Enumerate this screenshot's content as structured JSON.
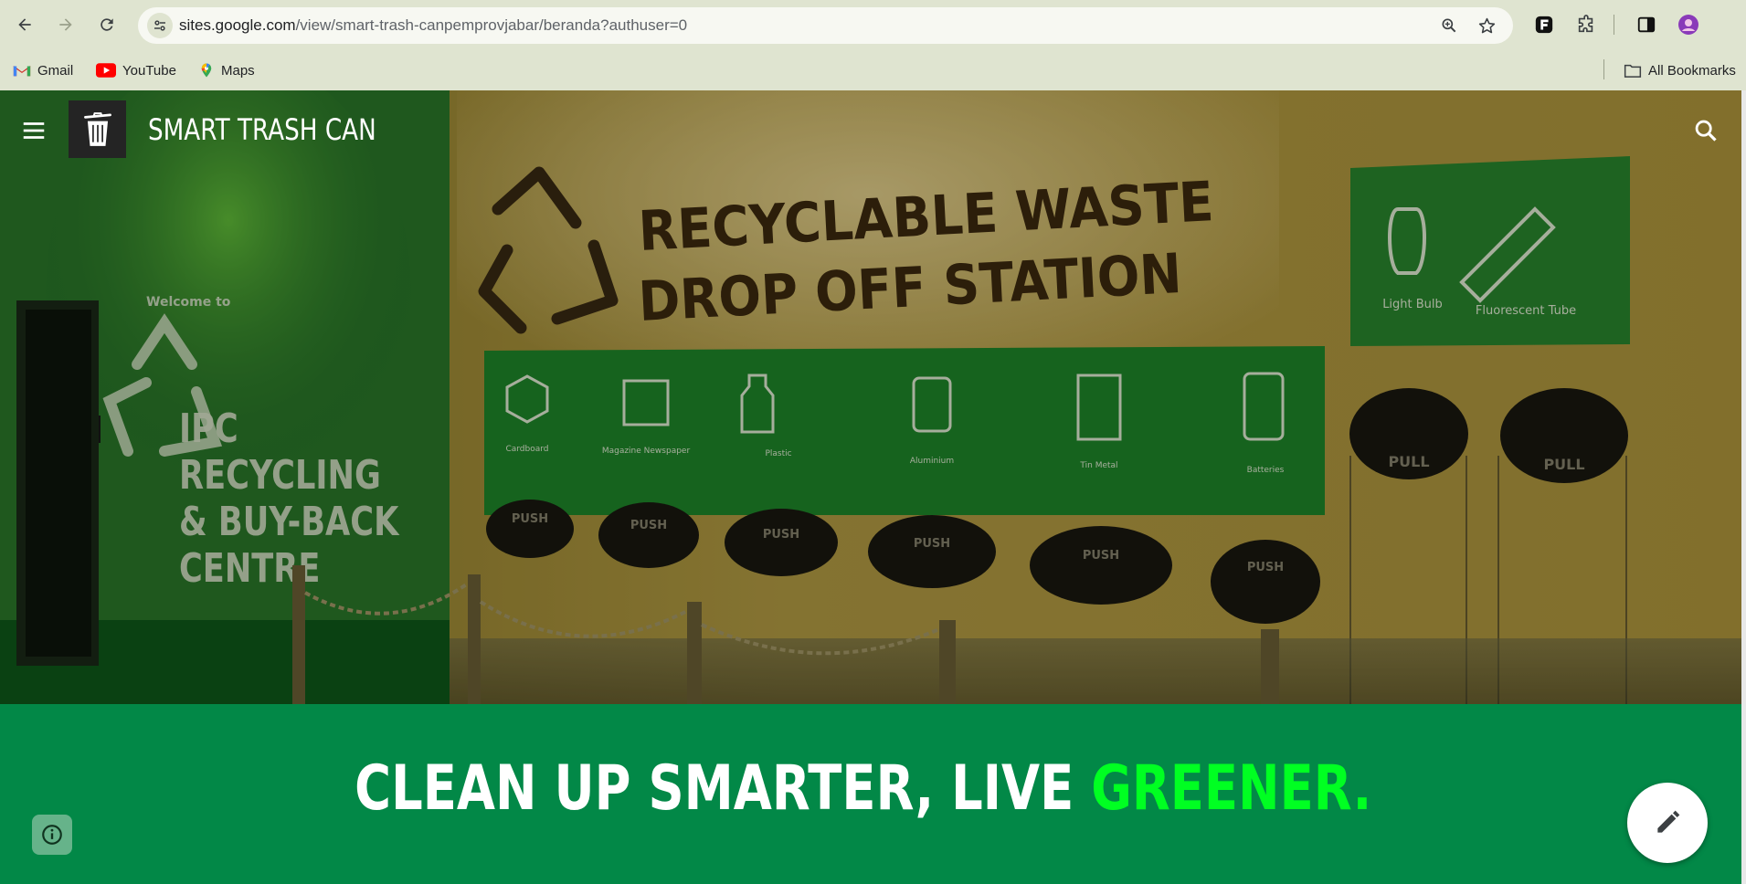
{
  "browser": {
    "url_host": "sites.google.com",
    "url_path": "/view/smart-trash-canpemprovjabar/beranda?authuser=0",
    "icons": [
      "back-icon",
      "forward-icon",
      "reload-icon",
      "site-info-icon",
      "zoom-icon",
      "star-icon",
      "extension-icon",
      "puzzle-icon",
      "side-panel-icon",
      "profile-avatar"
    ],
    "bookmarks": [
      {
        "label": "Gmail",
        "icon": "gmail-icon"
      },
      {
        "label": "YouTube",
        "icon": "youtube-icon"
      },
      {
        "label": "Maps",
        "icon": "maps-icon"
      }
    ],
    "all_bookmarks": "All Bookmarks"
  },
  "site": {
    "title": "SMART TRASH CAN",
    "hero": {
      "sign_line1": "RECYCLABLE WASTE",
      "sign_line2": "DROP OFF STATION",
      "wall_text": [
        "IPC",
        "RECYCLING",
        "& BUY-BACK",
        "CENTRE"
      ],
      "wall_small": "Welcome to",
      "bin_labels": [
        "Cardboard",
        "Magazine Newspaper",
        "Plastic",
        "Aluminium",
        "Tin Metal",
        "Batteries"
      ],
      "push_labels": [
        "PUSH",
        "PUSH",
        "PUSH",
        "PUSH",
        "PUSH",
        "PUSH"
      ],
      "pull_labels": [
        "PULL",
        "PULL"
      ],
      "side_labels": [
        "Light Bulb",
        "Fluorescent Tube"
      ]
    },
    "headline_main": "CLEAN UP SMARTER, LIVE ",
    "headline_accent": "GREENER."
  },
  "colors": {
    "chrome": "#dfe4d0",
    "band_green": "#028847",
    "accent_green": "#00ff22",
    "info_button": "#66b38a"
  }
}
